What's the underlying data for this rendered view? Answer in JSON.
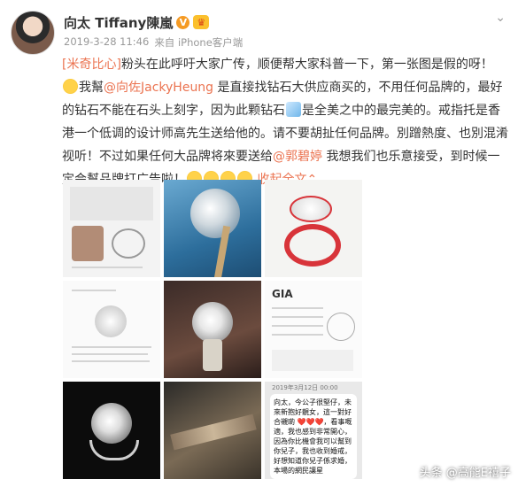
{
  "profile": {
    "name": "向太 Tiffany陳嵐",
    "verified_icon": "verified-v-badge",
    "member_icon": "vip-crown-icon"
  },
  "meta": {
    "timestamp": "2019-3-28 11:46",
    "source": "来自 iPhone客户端"
  },
  "post": {
    "tag": "[米奇比心]",
    "line1_a": "粉头在此呼吁大家广传，顺便帮大家科普一下，第一张图是假的呀！",
    "line2_prefix": "我幫",
    "mention1": "@向佐JackyHeung",
    "line2_mid": " 是直接找钻石大供应商买的，不用任何品牌的，最好的钻石不能在石头上刻字，因为此颗钻石",
    "line2_after_emoji": "是全美之中的最完美的。戒指托是香港一个低调的设计师高先生送给他的。请不要胡扯任何品牌。別蹭熱度、也別混淆视听！不过如果任何大品牌将來要送给",
    "mention2": "@郭碧婷",
    "line3_mid": " 我想我们也乐意接受，到时候一定会幫品牌打广告啦！",
    "collapse": "收起全文",
    "collapse_arrow": "⌃"
  },
  "images": {
    "img6_heading": "GIA",
    "img9_bubble_date": "2019年3月12日 00:00",
    "img9_text": "向太，今公子很堅仔，未來新抱好靚女，這一對好合襯啲 ❤️❤️❤️，看事嘅適，我也感到非常開心，因為你比機會我可以幫到你兒子，我也收到婚戒，好想知道你兒子係求婚，本場的網民讓星"
  },
  "watermark": "头条 @高能E禧子",
  "colors": {
    "link": "#eb7350",
    "meta": "#999999",
    "text": "#333333"
  }
}
